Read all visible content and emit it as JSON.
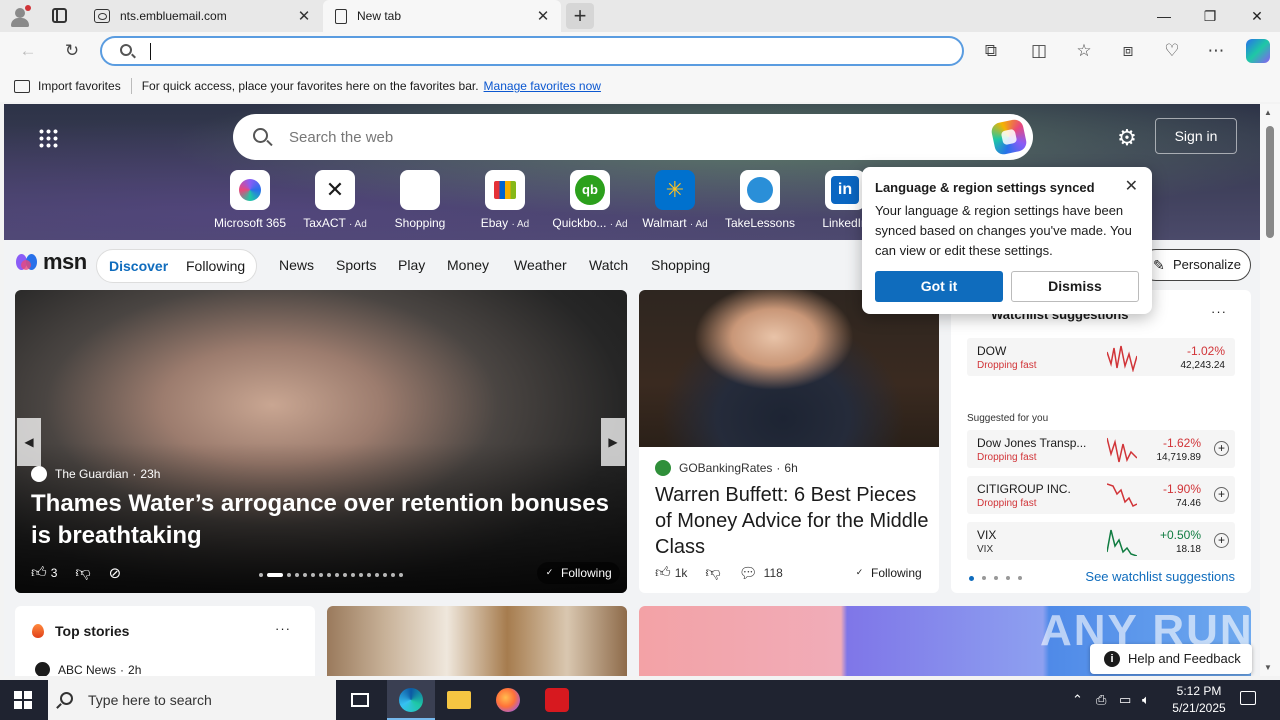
{
  "browser": {
    "tabs": [
      {
        "title": "nts.embluemail.com",
        "icon": "globe-icon"
      },
      {
        "title": "New tab",
        "icon": "page-icon"
      }
    ],
    "new_tab_label": "+",
    "address_value": ""
  },
  "favorites_bar": {
    "import_label": "Import favorites",
    "message": "For quick access, place your favorites here on the favorites bar.",
    "manage_link": "Manage favorites now"
  },
  "hero": {
    "search_placeholder": "Search the web",
    "sign_in": "Sign in",
    "shortcuts": [
      {
        "label": "Microsoft 365",
        "ad": ""
      },
      {
        "label": "TaxACT",
        "ad": "· Ad"
      },
      {
        "label": "Shopping",
        "ad": ""
      },
      {
        "label": "Ebay",
        "ad": "· Ad"
      },
      {
        "label": "Quickbo...",
        "ad": "· Ad"
      },
      {
        "label": "Walmart",
        "ad": "· Ad"
      },
      {
        "label": "TakeLessons",
        "ad": ""
      },
      {
        "label": "LinkedIn",
        "ad": ""
      }
    ]
  },
  "msn": {
    "logo_text": "msn",
    "feed_tabs": [
      "Discover",
      "Following"
    ],
    "nav": [
      "News",
      "Sports",
      "Play",
      "Money",
      "Weather",
      "Watch",
      "Shopping"
    ],
    "personalize": "Personalize"
  },
  "main_story": {
    "source": "The Guardian",
    "age": "23h",
    "headline": "Thames Water’s arrogance over retention bonuses is breathtaking",
    "likes": "3",
    "following": "Following"
  },
  "side_story": {
    "source": "GOBankingRates",
    "age": "6h",
    "headline": "Warren Buffett: 6 Best Pieces of Money Advice for the Middle Class",
    "likes": "1k",
    "comments": "118",
    "following": "Following"
  },
  "watchlist": {
    "title": "Watchlist suggestions",
    "more": "···",
    "featured": {
      "name": "DOW",
      "status": "Dropping fast",
      "change": "-1.02%",
      "value": "42,243.24"
    },
    "suggested_label": "Suggested for you",
    "suggestions": [
      {
        "name": "Dow Jones Transp...",
        "status": "Dropping fast",
        "change": "-1.62%",
        "value": "14,719.89"
      },
      {
        "name": "CITIGROUP INC.",
        "status": "Dropping fast",
        "change": "-1.90%",
        "value": "74.46"
      },
      {
        "name": "VIX",
        "status": "VIX",
        "change": "+0.50%",
        "value": "18.18"
      }
    ],
    "see_more": "See watchlist suggestions"
  },
  "top_stories": {
    "title": "Top stories",
    "more": "···",
    "source": "ABC News",
    "age": "2h"
  },
  "help_feedback": "Help and Feedback",
  "watermark": "ANY RUN",
  "popup": {
    "title": "Language & region settings synced",
    "message": "Your language & region settings have been synced based on changes you've made. You can view or edit these settings.",
    "primary": "Got it",
    "secondary": "Dismiss"
  },
  "taskbar": {
    "search_placeholder": "Type here to search",
    "time": "5:12 PM",
    "date": "5/21/2025"
  },
  "colors": {
    "accent": "#0f6cbd",
    "down": "#d13438",
    "up": "#107c41",
    "taskbar": "#1f2330"
  }
}
